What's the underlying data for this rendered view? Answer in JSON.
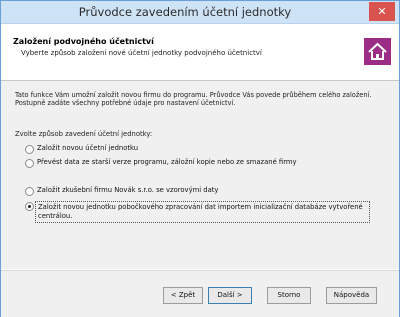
{
  "window": {
    "title": "Průvodce zavedením účetní jednotky",
    "close_glyph": "✕"
  },
  "header": {
    "title": "Založení podvojného účetnictví",
    "subtitle": "Vyberte způsob založení nové účetní jednotky podvojného účetnictví",
    "icon": "house-icon"
  },
  "content": {
    "intro": "Tato funkce Vám umožní založit novou firmu do programu. Průvodce Vás povede průběhem celého založení. Postupně zadáte všechny potřebné údaje pro nastavení účetnictví.",
    "prompt": "Zvolte způsob zavedení účetní jednotky:",
    "options": [
      {
        "label": "Založit novou účetní jednotku",
        "checked": false
      },
      {
        "label": "Převést data ze starší verze programu, záložní kopie nebo ze smazané firmy",
        "checked": false
      },
      {
        "label": "Založit zkušební firmu Novák s.r.o. se vzorovými daty",
        "checked": false
      },
      {
        "label": "Založit novou jednotku pobočkového zpracování dat importem inicializační databáze vytvořené centrálou.",
        "checked": true
      }
    ]
  },
  "footer": {
    "back": "< Zpět",
    "next": "Další >",
    "cancel": "Storno",
    "help": "Nápověda"
  }
}
